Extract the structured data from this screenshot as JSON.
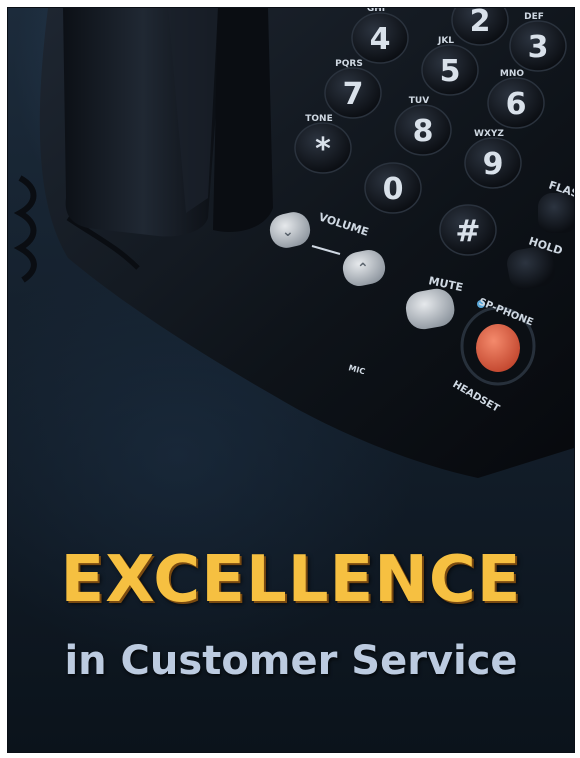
{
  "poster": {
    "title": "EXCELLENCE",
    "subtitle": "in Customer Service"
  },
  "phone": {
    "keys": [
      {
        "digit": "4",
        "letters": "GHI"
      },
      {
        "digit": "5",
        "letters": "JKL"
      },
      {
        "digit": "3",
        "letters": "DEF"
      },
      {
        "digit": "7",
        "letters": "PQRS"
      },
      {
        "digit": "6",
        "letters": "MNO"
      },
      {
        "digit": "8",
        "letters": "TUV"
      },
      {
        "digit": "9",
        "letters": "WXYZ"
      },
      {
        "digit": "*",
        "letters": "TONE"
      },
      {
        "digit": "0",
        "letters": ""
      },
      {
        "digit": "#",
        "letters": ""
      },
      {
        "digit": "2",
        "letters": ""
      }
    ],
    "labels": {
      "flash": "FLAS",
      "hold": "HOLD",
      "volume": "VOLUME",
      "mute": "MUTE",
      "sp_phone": "SP-PHONE",
      "headset": "HEADSET",
      "mic": "MIC"
    }
  },
  "colors": {
    "title": "#f6c041",
    "subtitle": "#bccbe0",
    "speaker_button": "#e8674a",
    "background": "#15212e"
  }
}
